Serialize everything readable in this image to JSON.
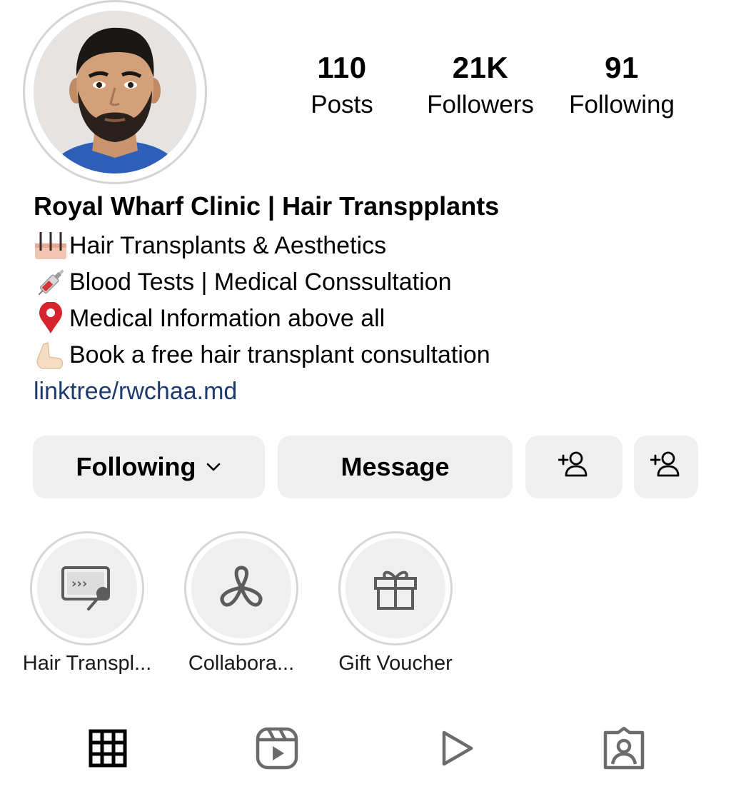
{
  "profile": {
    "name": "Royal Wharf Clinic | Hair  Transpplants",
    "avatar_icon": "profile-photo"
  },
  "stats": [
    {
      "value": "110",
      "label": "Posts"
    },
    {
      "value": "21K",
      "label": "Followers"
    },
    {
      "value": "91",
      "label": "Following"
    }
  ],
  "bio": {
    "lines": [
      {
        "emoji": "hair-follicle-icon",
        "text": "Hair Transplants & Aesthetics"
      },
      {
        "emoji": "syringe-icon",
        "text": "Blood Tests | Medical Conssultation"
      },
      {
        "emoji": "round-pushpin-icon",
        "text": "Medical Information above all"
      },
      {
        "emoji": "down-pointing-hand-icon",
        "text": "Book a free hair transplant consultation"
      }
    ],
    "link": "linktree/rwchaa.md"
  },
  "actions": {
    "following_label": "Following",
    "message_label": "Message",
    "add_user_icon": "person-add-icon",
    "suggested_icon": "person-add-icon"
  },
  "highlights": [
    {
      "label": "Hair Transpl...",
      "icon": "presentation-board-icon"
    },
    {
      "label": "Collabora...",
      "icon": "threads-knot-icon"
    },
    {
      "label": "Gift Voucher",
      "icon": "gift-icon"
    }
  ],
  "tabs": [
    {
      "name": "posts-grid",
      "icon": "grid-icon",
      "active": true
    },
    {
      "name": "reels",
      "icon": "reels-icon",
      "active": false
    },
    {
      "name": "videos",
      "icon": "play-icon",
      "active": false
    },
    {
      "name": "tagged",
      "icon": "tagged-person-icon",
      "active": false
    }
  ],
  "colors": {
    "link": "#1d3a6e",
    "button_bg": "#efefef",
    "ring": "#d4d4d4",
    "icon_gray": "#6b6b6b"
  }
}
